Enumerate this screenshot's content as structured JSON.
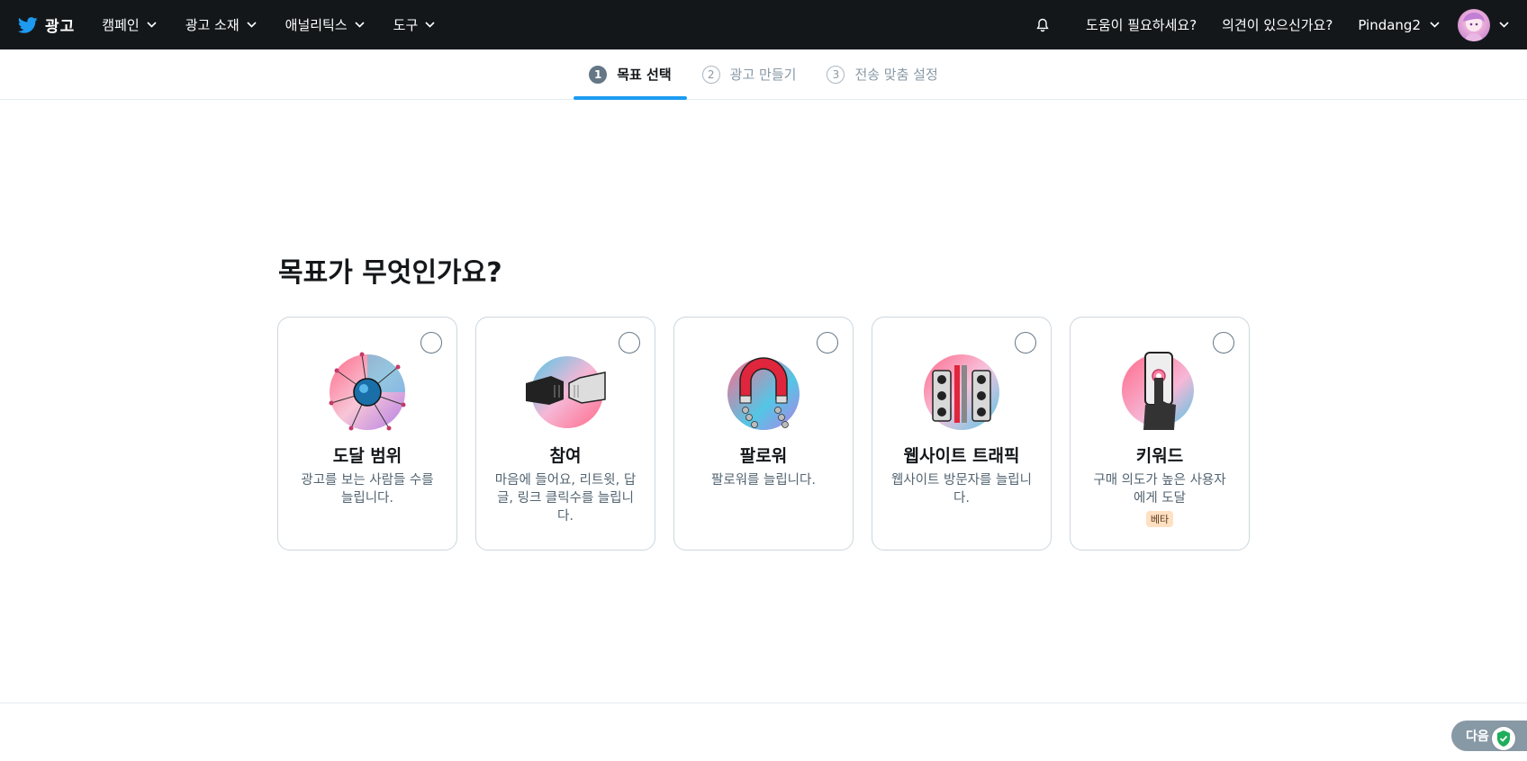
{
  "brand": {
    "label": "광고"
  },
  "nav": {
    "items": [
      {
        "label": "캠페인"
      },
      {
        "label": "광고 소재"
      },
      {
        "label": "애널리틱스"
      },
      {
        "label": "도구"
      }
    ],
    "help": "도움이 필요하세요?",
    "feedback": "의견이 있으신가요?",
    "account": "Pindang2"
  },
  "steps": [
    {
      "num": "1",
      "label": "목표 선택"
    },
    {
      "num": "2",
      "label": "광고 만들기"
    },
    {
      "num": "3",
      "label": "전송 맞춤 설정"
    }
  ],
  "main": {
    "title": "목표가 무엇인가요?",
    "cards": [
      {
        "title": "도달 범위",
        "desc": "광고를 보는 사람들 수를 늘립니다.",
        "icon": "reach-icon"
      },
      {
        "title": "참여",
        "desc": "마음에 들어요, 리트윗, 답글, 링크 클릭수를 늘립니다.",
        "icon": "engagement-icon"
      },
      {
        "title": "팔로워",
        "desc": "팔로워를 늘립니다.",
        "icon": "followers-icon"
      },
      {
        "title": "웹사이트 트래픽",
        "desc": "웹사이트 방문자를 늘립니다.",
        "icon": "traffic-light-icon"
      },
      {
        "title": "키워드",
        "desc": "구매 의도가 높은 사용자에게 도달",
        "badge": "베타",
        "icon": "keyword-icon"
      }
    ]
  },
  "footer": {
    "next": "다음"
  },
  "colors": {
    "accent": "#1d9bf0",
    "nav_bg": "#14171a",
    "badge_bg": "#ffe0c2"
  }
}
